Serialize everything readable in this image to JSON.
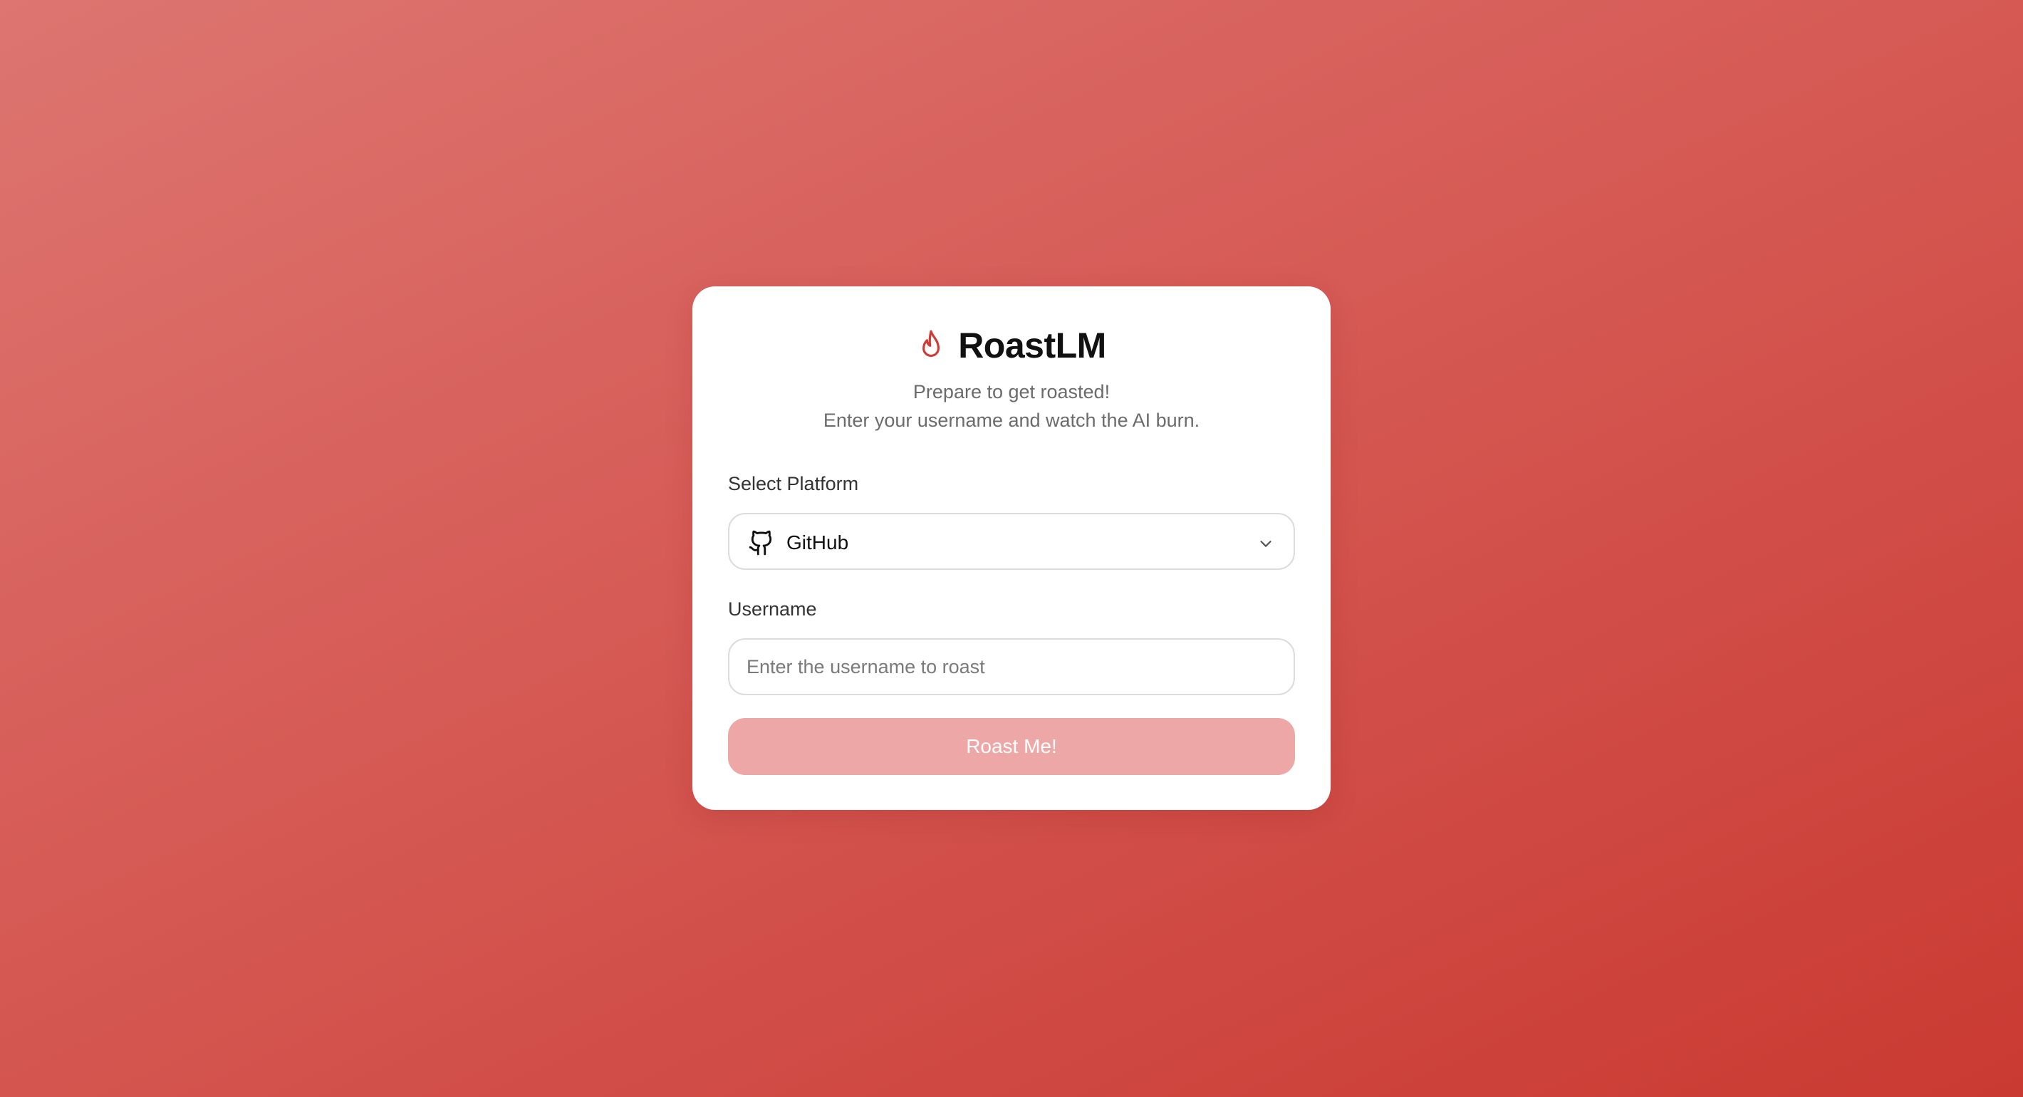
{
  "app": {
    "title": "RoastLM",
    "icon": "flame-icon",
    "accent_color": "#d03c35"
  },
  "subtitle": {
    "line1": "Prepare to get roasted!",
    "line2": "Enter your username and watch the AI burn."
  },
  "platform": {
    "label": "Select Platform",
    "selected": "GitHub",
    "selected_icon": "github-icon",
    "dropdown_icon": "chevron-down-icon"
  },
  "username": {
    "label": "Username",
    "value": "",
    "placeholder": "Enter the username to roast"
  },
  "submit": {
    "label": "Roast Me!",
    "color": "#eda7a6"
  }
}
